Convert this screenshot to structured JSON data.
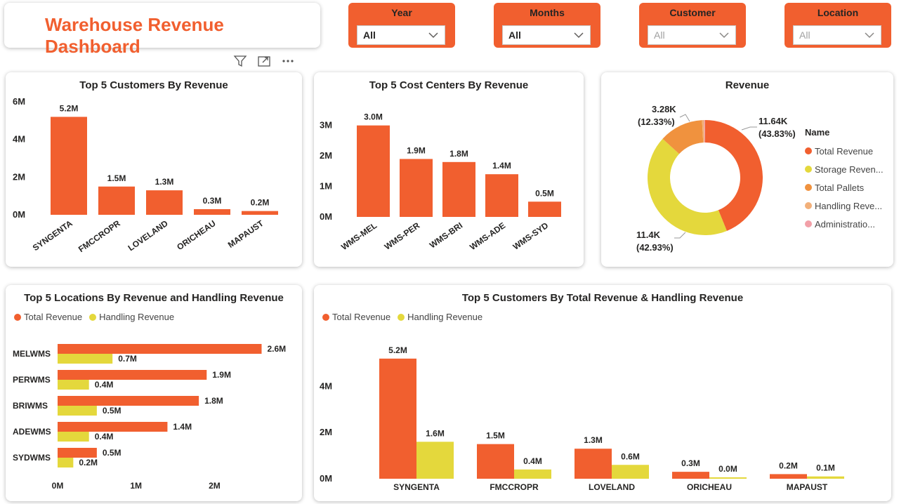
{
  "title": "Warehouse Revenue Dashboard",
  "filters": [
    {
      "label": "Year",
      "value": "All",
      "style": "bold"
    },
    {
      "label": "Months",
      "value": "All",
      "style": "bold"
    },
    {
      "label": "Customer",
      "value": "All",
      "style": "light"
    },
    {
      "label": "Location",
      "value": "All",
      "style": "light"
    }
  ],
  "colors": {
    "accent": "#F15F2F",
    "yellow": "#E4D83C",
    "orange2": "#F0923E",
    "peach": "#F2B07A",
    "pink": "#F2A0A8"
  },
  "chart_data": [
    {
      "type": "bar",
      "title": "Top 5 Customers By Revenue",
      "categories": [
        "SYNGENTA",
        "FMCCROPR",
        "LOVELAND",
        "ORICHEAU",
        "MAPAUST"
      ],
      "values": [
        5.2,
        1.5,
        1.3,
        0.3,
        0.2
      ],
      "value_labels": [
        "5.2M",
        "1.5M",
        "1.3M",
        "0.3M",
        "0.2M"
      ],
      "y_ticks": [
        "0M",
        "2M",
        "4M",
        "6M"
      ],
      "ylim": [
        0,
        6
      ]
    },
    {
      "type": "bar",
      "title": "Top 5 Cost Centers By Revenue",
      "categories": [
        "WMS-MEL",
        "WMS-PER",
        "WMS-BRI",
        "WMS-ADE",
        "WMS-SYD"
      ],
      "values": [
        3.0,
        1.9,
        1.8,
        1.4,
        0.5
      ],
      "value_labels": [
        "3.0M",
        "1.9M",
        "1.8M",
        "1.4M",
        "0.5M"
      ],
      "y_ticks": [
        "0M",
        "1M",
        "2M",
        "3M"
      ],
      "ylim": [
        0,
        3.2
      ]
    },
    {
      "type": "pie",
      "title": "Revenue",
      "legend_title": "Name",
      "legend": [
        "Total Revenue",
        "Storage Reven...",
        "Total Pallets",
        "Handling Reve...",
        "Administratio..."
      ],
      "values": [
        11.64,
        11.4,
        3.28,
        0.15,
        0.08
      ],
      "labels": [
        {
          "value": "11.64K",
          "pct": "(43.83%)"
        },
        {
          "value": "11.4K",
          "pct": "(42.93%)"
        },
        {
          "value": "3.28K",
          "pct": "(12.33%)"
        }
      ]
    },
    {
      "type": "bar",
      "orientation": "horizontal",
      "title": "Top 5 Locations By Revenue and Handling Revenue",
      "categories": [
        "MELWMS",
        "PERWMS",
        "BRIWMS",
        "ADEWMS",
        "SYDWMS"
      ],
      "series": [
        {
          "name": "Total Revenue",
          "values": [
            2.6,
            1.9,
            1.8,
            1.4,
            0.5
          ],
          "labels": [
            "2.6M",
            "1.9M",
            "1.8M",
            "1.4M",
            "0.5M"
          ]
        },
        {
          "name": "Handling Revenue",
          "values": [
            0.7,
            0.4,
            0.5,
            0.4,
            0.2
          ],
          "labels": [
            "0.7M",
            "0.4M",
            "0.5M",
            "0.4M",
            "0.2M"
          ]
        }
      ],
      "x_ticks": [
        "0M",
        "1M",
        "2M"
      ],
      "xlim": [
        0,
        2.9
      ]
    },
    {
      "type": "bar",
      "title": "Top 5 Customers By Total Revenue & Handling Revenue",
      "categories": [
        "SYNGENTA",
        "FMCCROPR",
        "LOVELAND",
        "ORICHEAU",
        "MAPAUST"
      ],
      "series": [
        {
          "name": "Total Revenue",
          "values": [
            5.2,
            1.5,
            1.3,
            0.3,
            0.2
          ],
          "labels": [
            "5.2M",
            "1.5M",
            "1.3M",
            "0.3M",
            "0.2M"
          ]
        },
        {
          "name": "Handling Revenue",
          "values": [
            1.6,
            0.4,
            0.6,
            0.0,
            0.1
          ],
          "labels": [
            "1.6M",
            "0.4M",
            "0.6M",
            "0.0M",
            "0.1M"
          ]
        }
      ],
      "y_ticks": [
        "0M",
        "2M",
        "4M"
      ],
      "ylim": [
        0,
        5.5
      ]
    }
  ]
}
